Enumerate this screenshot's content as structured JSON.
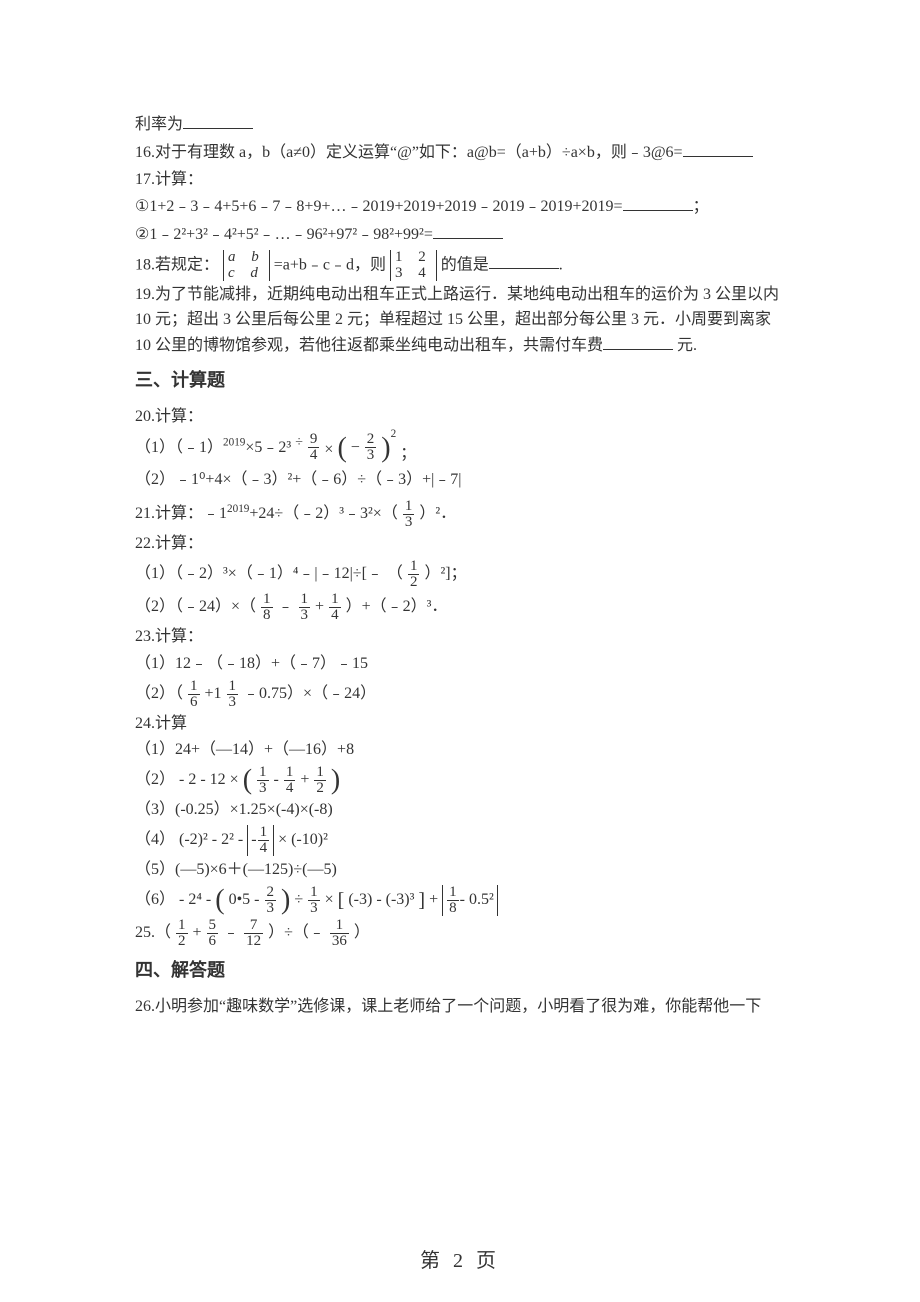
{
  "top": {
    "q15_tail": "利率为",
    "q16": "16.对于有理数 a，b（a≠0）定义运算“@”如下：a@b=（a+b）÷a×b，则﹣3@6=",
    "q17_head": "17.计算：",
    "q17_1_pre": "①1+2﹣3﹣4+5+6﹣7﹣8+9+…﹣2019+2019+2019﹣2019﹣2019+2019=",
    "q17_1_post": "；",
    "q17_2_pre": "②1﹣2²+3²﹣4²+5²﹣…﹣96²+97²﹣98²+99²=",
    "q18_pre": "18.若规定：",
    "q18_mid": "=a+b﹣c﹣d，则",
    "q18_post": "的值是",
    "q18_end": ".",
    "q19": "19.为了节能减排，近期纯电动出租车正式上路运行．某地纯电动出租车的运价为 3 公里以内 10 元；超出 3 公里后每公里 2 元；单程超过 15 公里，超出部分每公里 3 元．小周要到离家 10 公里的博物馆参观，若他往返都乘坐纯电动出租车，共需付车费",
    "q19_end": " 元.",
    "det1": {
      "r1": "a b",
      "r2": "c d"
    },
    "det2": {
      "r1": "1 2",
      "r2": "3 4"
    }
  },
  "sec3": "三、计算题",
  "sec4": "四、解答题",
  "q20": {
    "head": "20.计算：",
    "p1a": "（1）（﹣1）",
    "p1exp": "2019",
    "p1b": "×5﹣2³",
    "p1div": "÷",
    "p1mul": "×",
    "p1end": "；",
    "p2": "（2）﹣1⁰+4×（﹣3）²+（﹣6）÷（﹣3）+|﹣7|"
  },
  "q21": {
    "pre": "21.计算：﹣1",
    "exp": "2019",
    "mid": "+24÷（﹣2）³﹣3²×（",
    "post": "）²．"
  },
  "q22": {
    "head": "22.计算：",
    "p1a": "（1）（﹣2）³×（﹣1）⁴﹣|﹣12|÷[﹣",
    "p1b": "（",
    "p1c": "）²]；",
    "p2a": "（2）（﹣24）×（",
    "p2b": "﹣",
    "p2c": "+",
    "p2d": "）+（﹣2）³．"
  },
  "q23": {
    "head": "23.计算：",
    "p1": "（1）12﹣（﹣18）+（﹣7）﹣15",
    "p2a": "（2）（",
    "p2b": "+1",
    "p2c": "﹣0.75）×（﹣24）"
  },
  "q24": {
    "head": "24.计算",
    "p1": "（1）24+（—14）+（—16）+8",
    "p2a": "（2）",
    "p2txt_a": "- 2 - 12 ×",
    "p3": "（3）(-0.25）×1.25×(-4)×(-8)",
    "p4a": "（4）",
    "p4txt_a": "(-2)² - 2² -",
    "p4txt_b": "× (-10)²",
    "p5": "（5）(—5)×6＋(—125)÷(—5)",
    "p6a": "（6）",
    "p6txt_a": "- 2⁴ -",
    "p6txt_b": "0•5 -",
    "p6txt_c": "÷",
    "p6txt_d": "×",
    "p6txt_e": "(-3) - (-3)³",
    "p6txt_f": "+",
    "p6txt_g": "- 0.5²"
  },
  "q25": {
    "pre": "25.（",
    "plus": "+",
    "minus": "﹣",
    "mid": "）÷（﹣",
    "post": "）"
  },
  "q26": "26.小明参加“趣味数学”选修课，课上老师给了一个问题，小明看了很为难，你能帮他一下",
  "pagenum": "第 2 页",
  "fracs": {
    "f9_4": {
      "n": "9",
      "d": "4"
    },
    "f2_3": {
      "n": "2",
      "d": "3"
    },
    "f1_3": {
      "n": "1",
      "d": "3"
    },
    "f1_2": {
      "n": "1",
      "d": "2"
    },
    "f1_8": {
      "n": "1",
      "d": "8"
    },
    "f1_4": {
      "n": "1",
      "d": "4"
    },
    "f1_6": {
      "n": "1",
      "d": "6"
    },
    "f5_6": {
      "n": "5",
      "d": "6"
    },
    "f7_12": {
      "n": "7",
      "d": "12"
    },
    "f1_36": {
      "n": "1",
      "d": "36"
    }
  }
}
